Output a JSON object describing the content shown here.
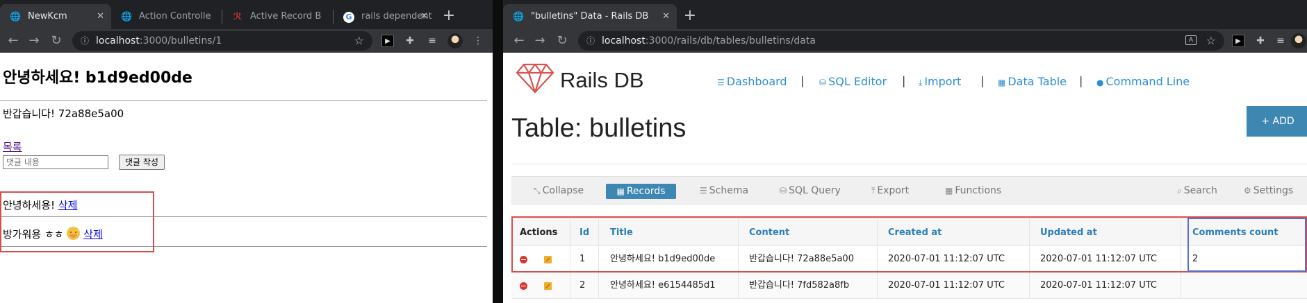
{
  "left_window": {
    "tabs": [
      {
        "title": "NewKcm",
        "active": true
      },
      {
        "title": "Action Controlle",
        "active": false
      },
      {
        "title": "Active Record B",
        "active": false
      },
      {
        "title": "rails dependent",
        "active": false
      }
    ],
    "address": {
      "host": "localhost",
      "rest": ":3000/bulletins/1"
    },
    "page": {
      "title": "안녕하세요! b1d9ed00de",
      "body": "반갑습니다! 72a88e5a00",
      "list_link": "목록",
      "comment_placeholder": "댓글 내용",
      "comment_button": "댓글 작성",
      "comments": [
        {
          "text": "안녕하세용!",
          "delete": "삭제"
        },
        {
          "text": "방가워용 ㅎㅎ",
          "delete": "삭제"
        }
      ]
    }
  },
  "right_window": {
    "tab": {
      "title": "\"bulletins\" Data - Rails DB"
    },
    "address": {
      "host": "localhost",
      "rest": ":3000/rails/db/tables/bulletins/data"
    },
    "logo": "Rails DB",
    "nav": [
      "Dashboard",
      "SQL Editor",
      "Import",
      "Data Table",
      "Command Line"
    ],
    "nav_separator": "|",
    "table_title": "Table: bulletins",
    "add_button": "+ ADD",
    "subnav": {
      "collapse": "Collapse",
      "records": "Records",
      "schema": "Schema",
      "sql_query": "SQL Query",
      "export": "Export",
      "functions": "Functions",
      "search": "Search",
      "settings": "Settings"
    },
    "columns": [
      "Actions",
      "Id",
      "Title",
      "Content",
      "Created at",
      "Updated at",
      "Comments count"
    ],
    "rows": [
      {
        "id": "1",
        "title": "안녕하세요! b1d9ed00de",
        "content": "반갑습니다! 72a88e5a00",
        "created_at": "2020-07-01 11:12:07 UTC",
        "updated_at": "2020-07-01 11:12:07 UTC",
        "comments_count": "2"
      },
      {
        "id": "2",
        "title": "안녕하세요! e6154485d1",
        "content": "반갑습니다! 7fd582a8fb",
        "created_at": "2020-07-01 11:12:07 UTC",
        "updated_at": "2020-07-01 11:12:07 UTC",
        "comments_count": ""
      }
    ]
  },
  "colors": {
    "accent": "#3d87b2",
    "link": "#2e8fd0",
    "highlight_red": "#d94c4c",
    "highlight_blue": "#5b6ccf"
  }
}
